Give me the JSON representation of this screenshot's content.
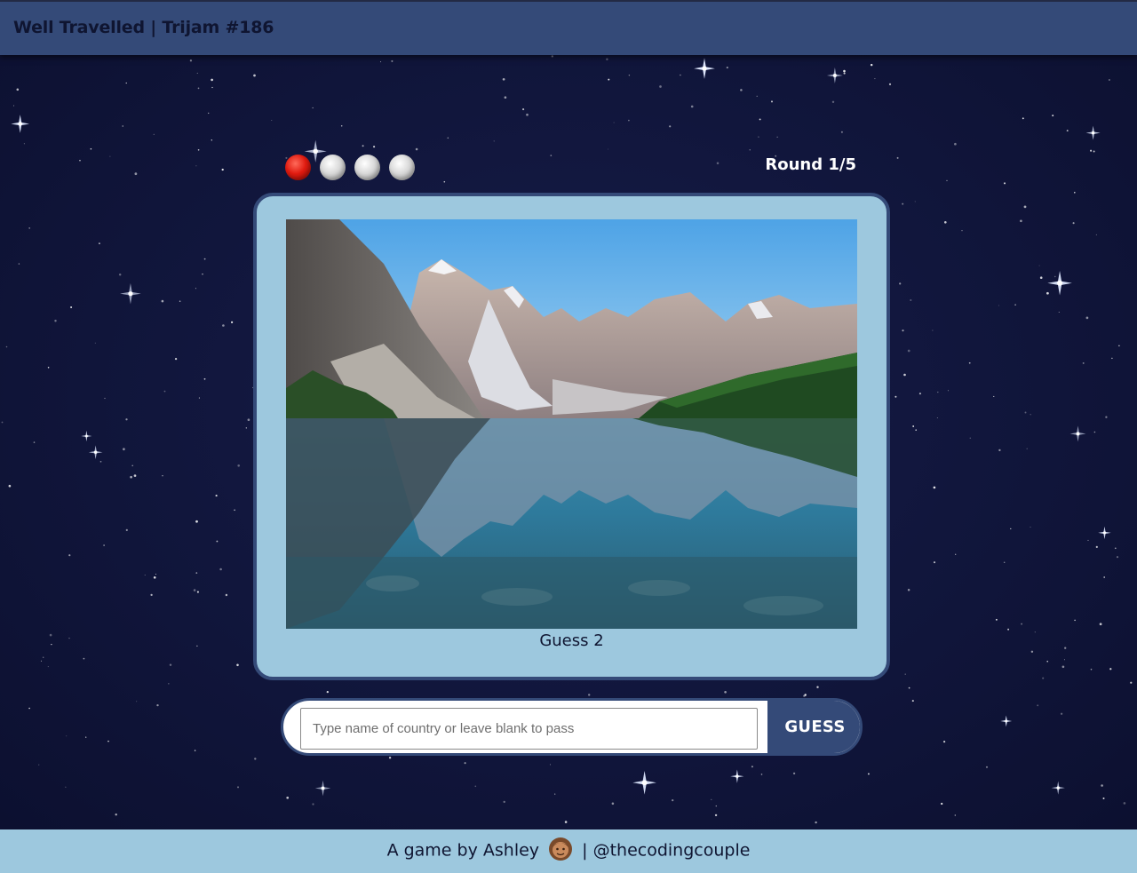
{
  "app": {
    "title": "Well Travelled | Trijam #186"
  },
  "game": {
    "round_label": "Round 1/5",
    "round_current": 1,
    "round_total": 5,
    "lives": [
      {
        "state": "lost",
        "color": "#e01b10"
      },
      {
        "state": "remaining",
        "color": "#d8d8d8"
      },
      {
        "state": "remaining",
        "color": "#d8d8d8"
      },
      {
        "state": "remaining",
        "color": "#d8d8d8"
      }
    ],
    "guess_label": "Guess 2",
    "photo_subject": "mountain lake reflection"
  },
  "form": {
    "input_placeholder": "Type name of country or leave blank to pass",
    "input_value": "",
    "guess_button_label": "GUESS"
  },
  "footer": {
    "credit_prefix": "A game by Ashley",
    "avatar_icon": "avatar-icon",
    "credit_suffix": "| @thecodingcouple"
  },
  "colors": {
    "header": "#344a78",
    "background": "#10153a",
    "card": "#9dc8de",
    "accent": "#344a78",
    "footer": "#9dc8de"
  }
}
